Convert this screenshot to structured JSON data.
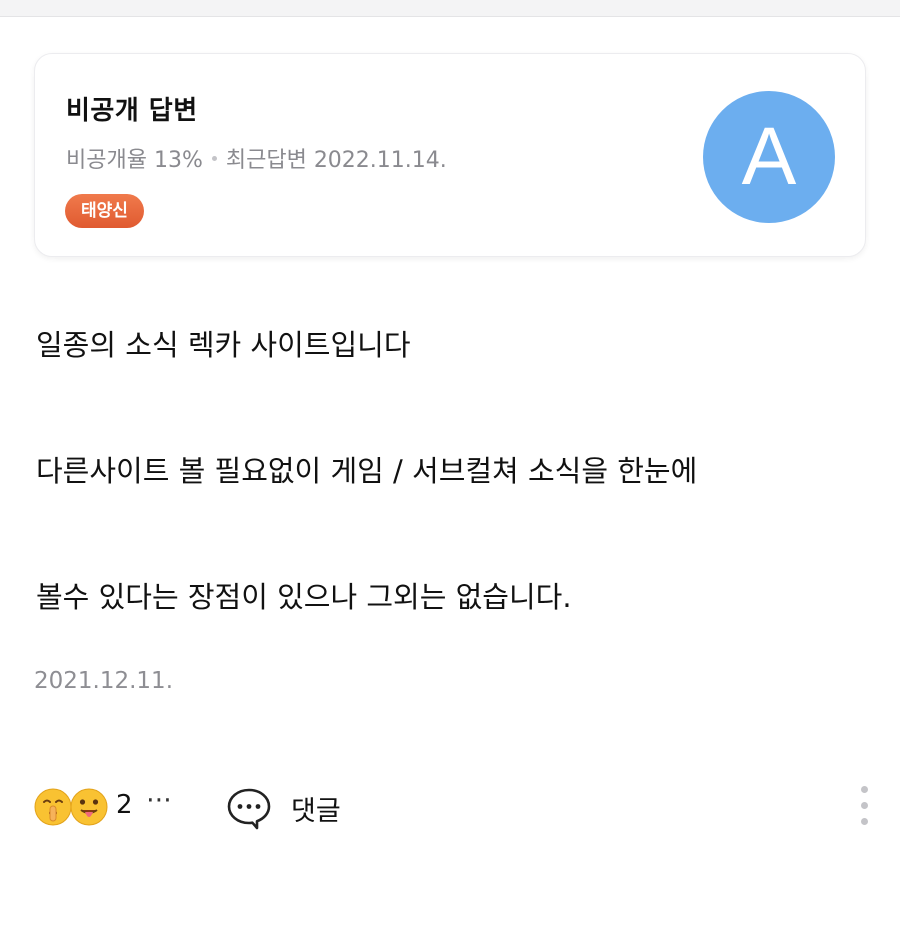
{
  "answer_card": {
    "title": "비공개 답변",
    "private_rate": "비공개율 13%",
    "recent_answer": "최근답변 2022.11.14.",
    "rank_badge": "태양신",
    "avatar_letter": "A",
    "avatar_color": "#6caeef"
  },
  "answer": {
    "lines": [
      "일종의 소식 렉카 사이트입니다",
      "다른사이트 볼 필요없이 게임 / 서브컬쳐 소식을 한눈에",
      "볼수 있다는 장점이 있으나 그외는 없습니다."
    ],
    "date": "2021.12.11."
  },
  "footer": {
    "reaction_icons": [
      "shushing-face-icon",
      "tongue-face-icon"
    ],
    "reaction_count": "2",
    "more_reactions_label": "⋯",
    "comment_label": "댓글"
  }
}
